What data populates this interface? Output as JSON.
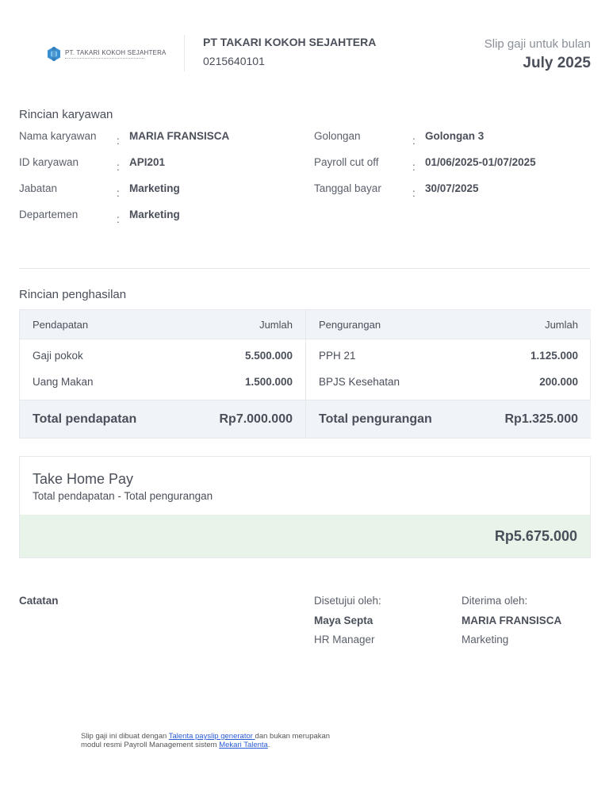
{
  "header": {
    "logo_text": "PT. TAKARI KOKOH SEJAHTERA",
    "company": "PT TAKARI KOKOH SEJAHTERA",
    "phone": "0215640101",
    "slip_label": "Slip gaji untuk bulan",
    "month": "July 2025"
  },
  "employee": {
    "title": "Rincian karyawan",
    "left": [
      {
        "label": "Nama karyawan",
        "value": "MARIA FRANSISCA"
      },
      {
        "label": "ID karyawan",
        "value": "API201"
      },
      {
        "label": "Jabatan",
        "value": "Marketing"
      },
      {
        "label": "Departemen",
        "value": "Marketing"
      }
    ],
    "right": [
      {
        "label": "Golongan",
        "value": "Golongan 3"
      },
      {
        "label": "Payroll cut off",
        "value": "01/06/2025-01/07/2025"
      },
      {
        "label": "Tanggal bayar",
        "value": "30/07/2025"
      }
    ],
    "colon": ":"
  },
  "income": {
    "title": "Rincian penghasilan",
    "earnings": {
      "header": "Pendapatan",
      "amount_header": "Jumlah",
      "rows": [
        {
          "name": "Gaji pokok",
          "amount": "5.500.000"
        },
        {
          "name": "Uang Makan",
          "amount": "1.500.000"
        }
      ],
      "total_label": "Total pendapatan",
      "total": "Rp7.000.000"
    },
    "deductions": {
      "header": "Pengurangan",
      "amount_header": "Jumlah",
      "rows": [
        {
          "name": "PPH 21",
          "amount": "1.125.000"
        },
        {
          "name": "BPJS Kesehatan",
          "amount": "200.000"
        }
      ],
      "total_label": "Total pengurangan",
      "total": "Rp1.325.000"
    }
  },
  "thp": {
    "title": "Take Home Pay",
    "subtitle": "Total pendapatan - Total pengurangan",
    "amount": "Rp5.675.000"
  },
  "notes": {
    "label": "Catatan",
    "approved_label": "Disetujui oleh:",
    "approved_name": "Maya Septa",
    "approved_role": "HR Manager",
    "received_label": "Diterima oleh:",
    "received_name": "MARIA FRANSISCA",
    "received_role": "Marketing"
  },
  "footer": {
    "t1": "Slip gaji ini dibuat dengan ",
    "link1": "Talenta payslip generator ",
    "t2": "dan bukan merupakan",
    "t3": "modul resmi Payroll Management sistem ",
    "link2": "Mekari Talenta",
    "t4": "."
  }
}
